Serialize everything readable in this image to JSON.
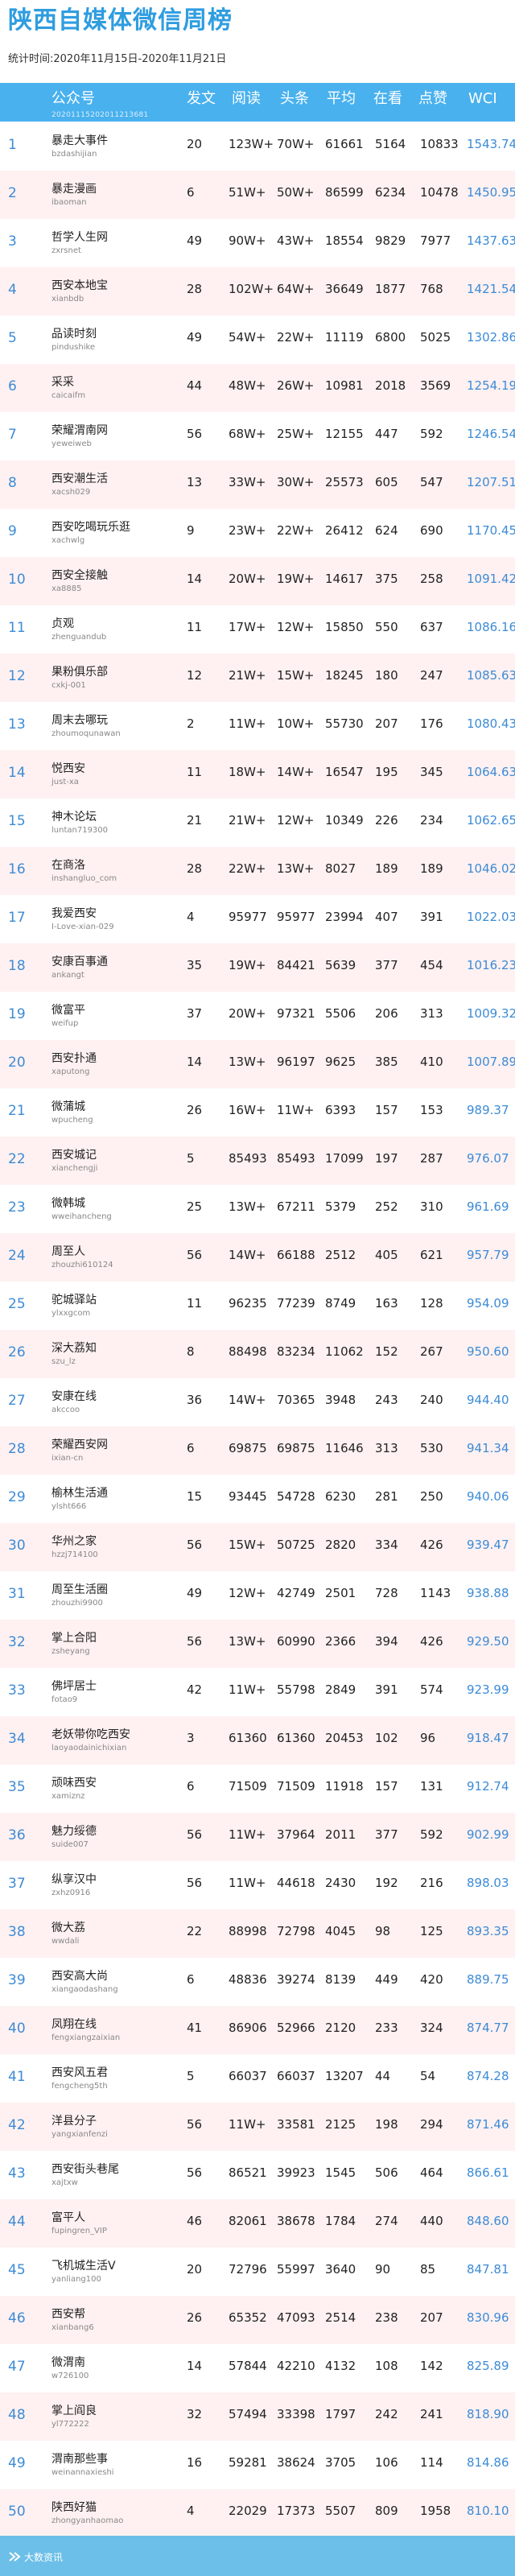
{
  "title": "陕西自媒体微信周榜",
  "subtitle": "统计时间:2020年11月15日-2020年11月21日",
  "header": {
    "cols": [
      "公众号",
      "发文",
      "阅读",
      "头条",
      "平均",
      "在看",
      "点赞",
      "WCI"
    ],
    "sub": "20201115202011213681"
  },
  "rows": [
    {
      "rank": "1",
      "name": "暴走大事件",
      "id": "bzdashijian",
      "posts": "20",
      "reads": "123W+",
      "head": "70W+",
      "avg": "61661",
      "look": "5164",
      "like": "10833",
      "wci": "1543.74"
    },
    {
      "rank": "2",
      "name": "暴走漫画",
      "id": "ibaoman",
      "posts": "6",
      "reads": "51W+",
      "head": "50W+",
      "avg": "86599",
      "look": "6234",
      "like": "10478",
      "wci": "1450.95"
    },
    {
      "rank": "3",
      "name": "哲学人生网",
      "id": "zxrsnet",
      "posts": "49",
      "reads": "90W+",
      "head": "43W+",
      "avg": "18554",
      "look": "9829",
      "like": "7977",
      "wci": "1437.63"
    },
    {
      "rank": "4",
      "name": "西安本地宝",
      "id": "xianbdb",
      "posts": "28",
      "reads": "102W+",
      "head": "64W+",
      "avg": "36649",
      "look": "1877",
      "like": "768",
      "wci": "1421.54"
    },
    {
      "rank": "5",
      "name": "品读时刻",
      "id": "pindushike",
      "posts": "49",
      "reads": "54W+",
      "head": "22W+",
      "avg": "11119",
      "look": "6800",
      "like": "5025",
      "wci": "1302.86"
    },
    {
      "rank": "6",
      "name": "采采",
      "id": "caicaifm",
      "posts": "44",
      "reads": "48W+",
      "head": "26W+",
      "avg": "10981",
      "look": "2018",
      "like": "3569",
      "wci": "1254.19"
    },
    {
      "rank": "7",
      "name": "荣耀渭南网",
      "id": "yeweiweb",
      "posts": "56",
      "reads": "68W+",
      "head": "25W+",
      "avg": "12155",
      "look": "447",
      "like": "592",
      "wci": "1246.54"
    },
    {
      "rank": "8",
      "name": "西安潮生活",
      "id": "xacsh029",
      "posts": "13",
      "reads": "33W+",
      "head": "30W+",
      "avg": "25573",
      "look": "605",
      "like": "547",
      "wci": "1207.51"
    },
    {
      "rank": "9",
      "name": "西安吃喝玩乐逛",
      "id": "xachwlg",
      "posts": "9",
      "reads": "23W+",
      "head": "22W+",
      "avg": "26412",
      "look": "624",
      "like": "690",
      "wci": "1170.45"
    },
    {
      "rank": "10",
      "name": "西安全接触",
      "id": "xa8885",
      "posts": "14",
      "reads": "20W+",
      "head": "19W+",
      "avg": "14617",
      "look": "375",
      "like": "258",
      "wci": "1091.42"
    },
    {
      "rank": "11",
      "name": "贞观",
      "id": "zhenguandub",
      "posts": "11",
      "reads": "17W+",
      "head": "12W+",
      "avg": "15850",
      "look": "550",
      "like": "637",
      "wci": "1086.16"
    },
    {
      "rank": "12",
      "name": "果粉俱乐部",
      "id": "cxkj-001",
      "posts": "12",
      "reads": "21W+",
      "head": "15W+",
      "avg": "18245",
      "look": "180",
      "like": "247",
      "wci": "1085.63"
    },
    {
      "rank": "13",
      "name": "周末去哪玩",
      "id": "zhoumoqunawan",
      "posts": "2",
      "reads": "11W+",
      "head": "10W+",
      "avg": "55730",
      "look": "207",
      "like": "176",
      "wci": "1080.43"
    },
    {
      "rank": "14",
      "name": "悦西安",
      "id": "just-xa",
      "posts": "11",
      "reads": "18W+",
      "head": "14W+",
      "avg": "16547",
      "look": "195",
      "like": "345",
      "wci": "1064.63"
    },
    {
      "rank": "15",
      "name": "神木论坛",
      "id": "luntan719300",
      "posts": "21",
      "reads": "21W+",
      "head": "12W+",
      "avg": "10349",
      "look": "226",
      "like": "234",
      "wci": "1062.65"
    },
    {
      "rank": "16",
      "name": "在商洛",
      "id": "inshangluo_com",
      "posts": "28",
      "reads": "22W+",
      "head": "13W+",
      "avg": "8027",
      "look": "189",
      "like": "189",
      "wci": "1046.02"
    },
    {
      "rank": "17",
      "name": "我爱西安",
      "id": "I-Love-xian-029",
      "posts": "4",
      "reads": "95977",
      "head": "95977",
      "avg": "23994",
      "look": "407",
      "like": "391",
      "wci": "1022.03"
    },
    {
      "rank": "18",
      "name": "安康百事通",
      "id": "ankangt",
      "posts": "35",
      "reads": "19W+",
      "head": "84421",
      "avg": "5639",
      "look": "377",
      "like": "454",
      "wci": "1016.23"
    },
    {
      "rank": "19",
      "name": "微富平",
      "id": "weifup",
      "posts": "37",
      "reads": "20W+",
      "head": "97321",
      "avg": "5506",
      "look": "206",
      "like": "313",
      "wci": "1009.32"
    },
    {
      "rank": "20",
      "name": "西安扑通",
      "id": "xaputong",
      "posts": "14",
      "reads": "13W+",
      "head": "96197",
      "avg": "9625",
      "look": "385",
      "like": "410",
      "wci": "1007.89"
    },
    {
      "rank": "21",
      "name": "微蒲城",
      "id": "wpucheng",
      "posts": "26",
      "reads": "16W+",
      "head": "11W+",
      "avg": "6393",
      "look": "157",
      "like": "153",
      "wci": "989.37"
    },
    {
      "rank": "22",
      "name": "西安城记",
      "id": "xianchengji",
      "posts": "5",
      "reads": "85493",
      "head": "85493",
      "avg": "17099",
      "look": "197",
      "like": "287",
      "wci": "976.07"
    },
    {
      "rank": "23",
      "name": "微韩城",
      "id": "wweihancheng",
      "posts": "25",
      "reads": "13W+",
      "head": "67211",
      "avg": "5379",
      "look": "252",
      "like": "310",
      "wci": "961.69"
    },
    {
      "rank": "24",
      "name": "周至人",
      "id": "zhouzhi610124",
      "posts": "56",
      "reads": "14W+",
      "head": "66188",
      "avg": "2512",
      "look": "405",
      "like": "621",
      "wci": "957.79"
    },
    {
      "rank": "25",
      "name": "驼城驿站",
      "id": "ylxxgcom",
      "posts": "11",
      "reads": "96235",
      "head": "77239",
      "avg": "8749",
      "look": "163",
      "like": "128",
      "wci": "954.09"
    },
    {
      "rank": "26",
      "name": "深大荔知",
      "id": "szu_lz",
      "posts": "8",
      "reads": "88498",
      "head": "83234",
      "avg": "11062",
      "look": "152",
      "like": "267",
      "wci": "950.60"
    },
    {
      "rank": "27",
      "name": "安康在线",
      "id": "akccoo",
      "posts": "36",
      "reads": "14W+",
      "head": "70365",
      "avg": "3948",
      "look": "243",
      "like": "240",
      "wci": "944.40"
    },
    {
      "rank": "28",
      "name": "荣耀西安网",
      "id": "ixian-cn",
      "posts": "6",
      "reads": "69875",
      "head": "69875",
      "avg": "11646",
      "look": "313",
      "like": "530",
      "wci": "941.34"
    },
    {
      "rank": "29",
      "name": "榆林生活通",
      "id": "ylsht666",
      "posts": "15",
      "reads": "93445",
      "head": "54728",
      "avg": "6230",
      "look": "281",
      "like": "250",
      "wci": "940.06"
    },
    {
      "rank": "30",
      "name": "华州之家",
      "id": "hzzj714100",
      "posts": "56",
      "reads": "15W+",
      "head": "50725",
      "avg": "2820",
      "look": "334",
      "like": "426",
      "wci": "939.47"
    },
    {
      "rank": "31",
      "name": "周至生活圈",
      "id": "zhouzhi9900",
      "posts": "49",
      "reads": "12W+",
      "head": "42749",
      "avg": "2501",
      "look": "728",
      "like": "1143",
      "wci": "938.88"
    },
    {
      "rank": "32",
      "name": "掌上合阳",
      "id": "zsheyang",
      "posts": "56",
      "reads": "13W+",
      "head": "60990",
      "avg": "2366",
      "look": "394",
      "like": "426",
      "wci": "929.50"
    },
    {
      "rank": "33",
      "name": "佛坪居士",
      "id": "fotao9",
      "posts": "42",
      "reads": "11W+",
      "head": "55798",
      "avg": "2849",
      "look": "391",
      "like": "574",
      "wci": "923.99"
    },
    {
      "rank": "34",
      "name": "老妖带你吃西安",
      "id": "laoyaodainichixian",
      "posts": "3",
      "reads": "61360",
      "head": "61360",
      "avg": "20453",
      "look": "102",
      "like": "96",
      "wci": "918.47"
    },
    {
      "rank": "35",
      "name": "顽味西安",
      "id": "xamiznz",
      "posts": "6",
      "reads": "71509",
      "head": "71509",
      "avg": "11918",
      "look": "157",
      "like": "131",
      "wci": "912.74"
    },
    {
      "rank": "36",
      "name": "魅力绥德",
      "id": "suide007",
      "posts": "56",
      "reads": "11W+",
      "head": "37964",
      "avg": "2011",
      "look": "377",
      "like": "592",
      "wci": "902.99"
    },
    {
      "rank": "37",
      "name": "纵享汉中",
      "id": "zxhz0916",
      "posts": "56",
      "reads": "11W+",
      "head": "44618",
      "avg": "2430",
      "look": "192",
      "like": "216",
      "wci": "898.03"
    },
    {
      "rank": "38",
      "name": "微大荔",
      "id": "wwdali",
      "posts": "22",
      "reads": "88998",
      "head": "72798",
      "avg": "4045",
      "look": "98",
      "like": "125",
      "wci": "893.35"
    },
    {
      "rank": "39",
      "name": "西安高大尚",
      "id": "xiangaodashang",
      "posts": "6",
      "reads": "48836",
      "head": "39274",
      "avg": "8139",
      "look": "449",
      "like": "420",
      "wci": "889.75"
    },
    {
      "rank": "40",
      "name": "凤翔在线",
      "id": "fengxiangzaixian",
      "posts": "41",
      "reads": "86906",
      "head": "52966",
      "avg": "2120",
      "look": "233",
      "like": "324",
      "wci": "874.77"
    },
    {
      "rank": "41",
      "name": "西安风五君",
      "id": "fengcheng5th",
      "posts": "5",
      "reads": "66037",
      "head": "66037",
      "avg": "13207",
      "look": "44",
      "like": "54",
      "wci": "874.28"
    },
    {
      "rank": "42",
      "name": "洋县分子",
      "id": "yangxianfenzi",
      "posts": "56",
      "reads": "11W+",
      "head": "33581",
      "avg": "2125",
      "look": "198",
      "like": "294",
      "wci": "871.46"
    },
    {
      "rank": "43",
      "name": "西安街头巷尾",
      "id": "xajtxw",
      "posts": "56",
      "reads": "86521",
      "head": "39923",
      "avg": "1545",
      "look": "506",
      "like": "464",
      "wci": "866.61"
    },
    {
      "rank": "44",
      "name": "富平人",
      "id": "fupingren_VIP",
      "posts": "46",
      "reads": "82061",
      "head": "38678",
      "avg": "1784",
      "look": "274",
      "like": "440",
      "wci": "848.60"
    },
    {
      "rank": "45",
      "name": "飞机城生活V",
      "id": "yanliang100",
      "posts": "20",
      "reads": "72796",
      "head": "55997",
      "avg": "3640",
      "look": "90",
      "like": "85",
      "wci": "847.81"
    },
    {
      "rank": "46",
      "name": "西安帮",
      "id": "xianbang6",
      "posts": "26",
      "reads": "65352",
      "head": "47093",
      "avg": "2514",
      "look": "238",
      "like": "207",
      "wci": "830.96"
    },
    {
      "rank": "47",
      "name": "微渭南",
      "id": "w726100",
      "posts": "14",
      "reads": "57844",
      "head": "42210",
      "avg": "4132",
      "look": "108",
      "like": "142",
      "wci": "825.89"
    },
    {
      "rank": "48",
      "name": "掌上阎良",
      "id": "yl772222",
      "posts": "32",
      "reads": "57494",
      "head": "33398",
      "avg": "1797",
      "look": "242",
      "like": "241",
      "wci": "818.90"
    },
    {
      "rank": "49",
      "name": "渭南那些事",
      "id": "weinannaxieshi",
      "posts": "16",
      "reads": "59281",
      "head": "38624",
      "avg": "3705",
      "look": "106",
      "like": "114",
      "wci": "814.86"
    },
    {
      "rank": "50",
      "name": "陕西好猫",
      "id": "zhongyanhaomao",
      "posts": "4",
      "reads": "22029",
      "head": "17373",
      "avg": "5507",
      "look": "809",
      "like": "1958",
      "wci": "810.10"
    }
  ],
  "footer": {
    "text": "大数资讯"
  }
}
